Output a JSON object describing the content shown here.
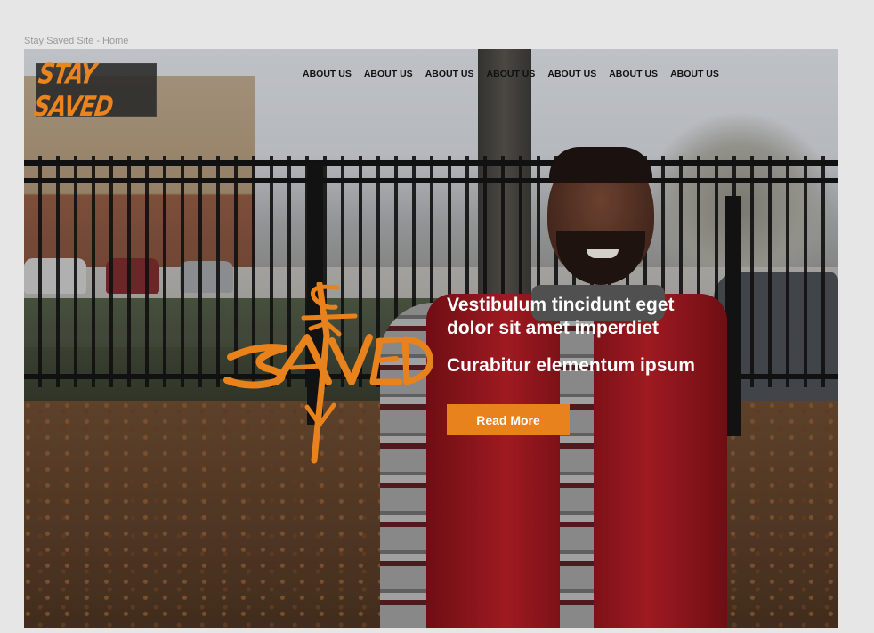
{
  "page": {
    "label": "Stay Saved Site - Home"
  },
  "header": {
    "logo_text": "STAY SAVED",
    "nav": [
      "ABOUT US",
      "ABOUT US",
      "ABOUT US",
      "ABOUT US",
      "ABOUT US",
      "ABOUT US",
      "ABOUT US"
    ]
  },
  "hero": {
    "emblem_text": "STAY SAVED",
    "title": "Vestibulum tincidunt eget dolor sit amet imperdiet",
    "subtitle": "Curabitur elementum ipsum",
    "cta_label": "Read More"
  },
  "colors": {
    "accent": "#e8821c",
    "logo_box": "#282828",
    "text_light": "#ffffff"
  },
  "icons": {
    "emblem": "stay-saved-cross-emblem"
  }
}
